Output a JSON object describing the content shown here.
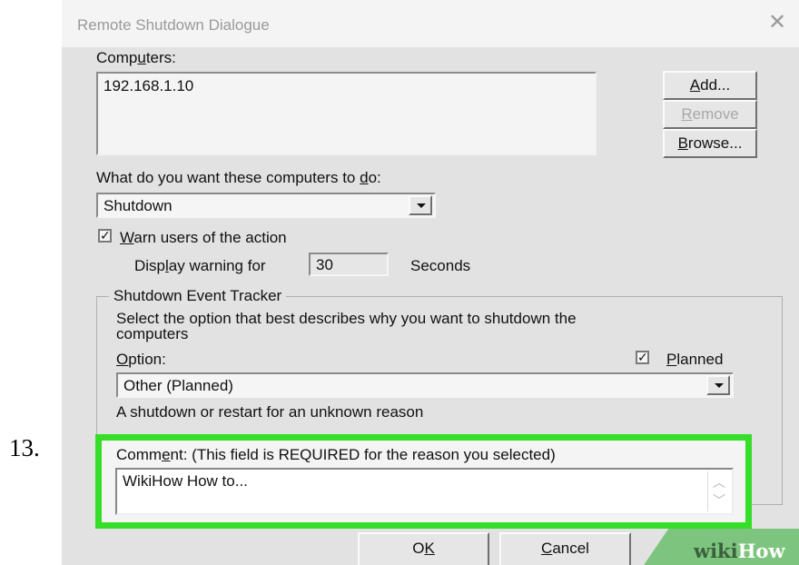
{
  "step_number": "13.",
  "dialog": {
    "title": "Remote Shutdown Dialogue",
    "close_glyph": "✕",
    "computers_label": {
      "pre": "Comp",
      "u": "u",
      "post": "ters:"
    },
    "computers": [
      "192.168.1.10"
    ],
    "add": {
      "u": "A",
      "post": "dd..."
    },
    "remove": {
      "u": "R",
      "post": "emove"
    },
    "browse": {
      "u": "B",
      "post": "rowse..."
    },
    "action_label": {
      "pre": "What do you want these computers to ",
      "u": "d",
      "post": "o:"
    },
    "action_value": "Shutdown",
    "warn_checked": "✓",
    "warn_label": {
      "u": "W",
      "post": "arn users of the action"
    },
    "display_label": {
      "pre": "Disp",
      "u": "l",
      "post": "ay warning for"
    },
    "display_value": "30",
    "seconds_label": "Seconds",
    "tracker": {
      "title": "Shutdown Event Tracker",
      "desc_line1": "Select the option that best describes why you want to shutdown the",
      "desc_line2": "computers",
      "option_label": {
        "u": "O",
        "post": "ption:"
      },
      "planned_checked": "✓",
      "planned_label": {
        "u": "P",
        "post": "lanned"
      },
      "option_value": "Other (Planned)",
      "option_description": "A shutdown or restart for an unknown reason"
    },
    "comment_label": {
      "pre": "Comm",
      "u": "e",
      "post": "nt: (This field is REQUIRED for the reason you selected)"
    },
    "comment_value": "WikiHow How to...",
    "ok": {
      "pre": "O",
      "u": "K",
      "post": ""
    },
    "cancel": {
      "u": "C",
      "post": "ancel"
    }
  },
  "watermark": {
    "a": "wiki",
    "b": "How"
  },
  "colors": {
    "highlight": "#36dd29",
    "watermark": "#7dc47e"
  }
}
